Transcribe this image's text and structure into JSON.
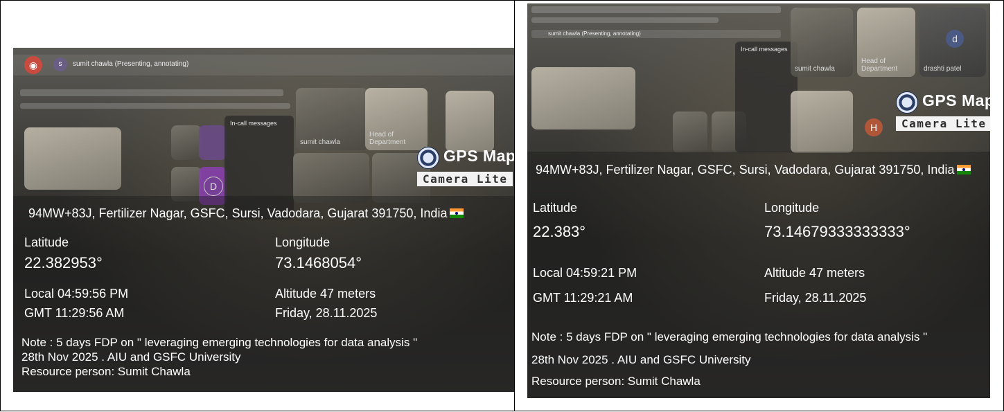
{
  "photos": [
    {
      "presenter": "sumit chawla (Presenting, annotating)",
      "chat_title": "In-call messages",
      "tiles": [
        "sumit chawla",
        "Head of Department"
      ],
      "avatar_letter": "D",
      "badge": {
        "title": "GPS Map",
        "subtitle": "Camera Lite"
      },
      "address": "94MW+83J, Fertilizer Nagar, GSFC, Sursi, Vadodara, Gujarat 391750, India",
      "latitude_label": "Latitude",
      "latitude": "22.382953°",
      "longitude_label": "Longitude",
      "longitude": "73.1468054°",
      "local_time": "Local 04:59:56 PM",
      "gmt_time": "GMT 11:29:56 AM",
      "altitude": "Altitude 47 meters",
      "date": "Friday, 28.11.2025",
      "note_line1": "Note : 5 days FDP on \" leveraging emerging technologies for data analysis \"",
      "note_line2": "28th Nov 2025 . AIU and GSFC University",
      "note_line3": "Resource person: Sumit Chawla"
    },
    {
      "presenter": "sumit chawla (Presenting, annotating)",
      "chat_title": "In-call messages",
      "tiles": [
        "sumit chawla",
        "Head of Department",
        "drashti patel"
      ],
      "avatar_letter": "d",
      "badge": {
        "title": "GPS Map",
        "subtitle": "Camera Lite"
      },
      "address": "94MW+83J, Fertilizer Nagar, GSFC, Sursi, Vadodara, Gujarat 391750, India",
      "latitude_label": "Latitude",
      "latitude": "22.383°",
      "longitude_label": "Longitude",
      "longitude": "73.14679333333333°",
      "local_time": "Local 04:59:21 PM",
      "gmt_time": "GMT 11:29:21 AM",
      "altitude": "Altitude 47 meters",
      "date": "Friday, 28.11.2025",
      "note_line1": "Note : 5 days FDP on \" leveraging emerging technologies for data analysis \"",
      "note_line2": "28th Nov 2025 . AIU and GSFC University",
      "note_line3": "Resource person: Sumit Chawla"
    }
  ]
}
